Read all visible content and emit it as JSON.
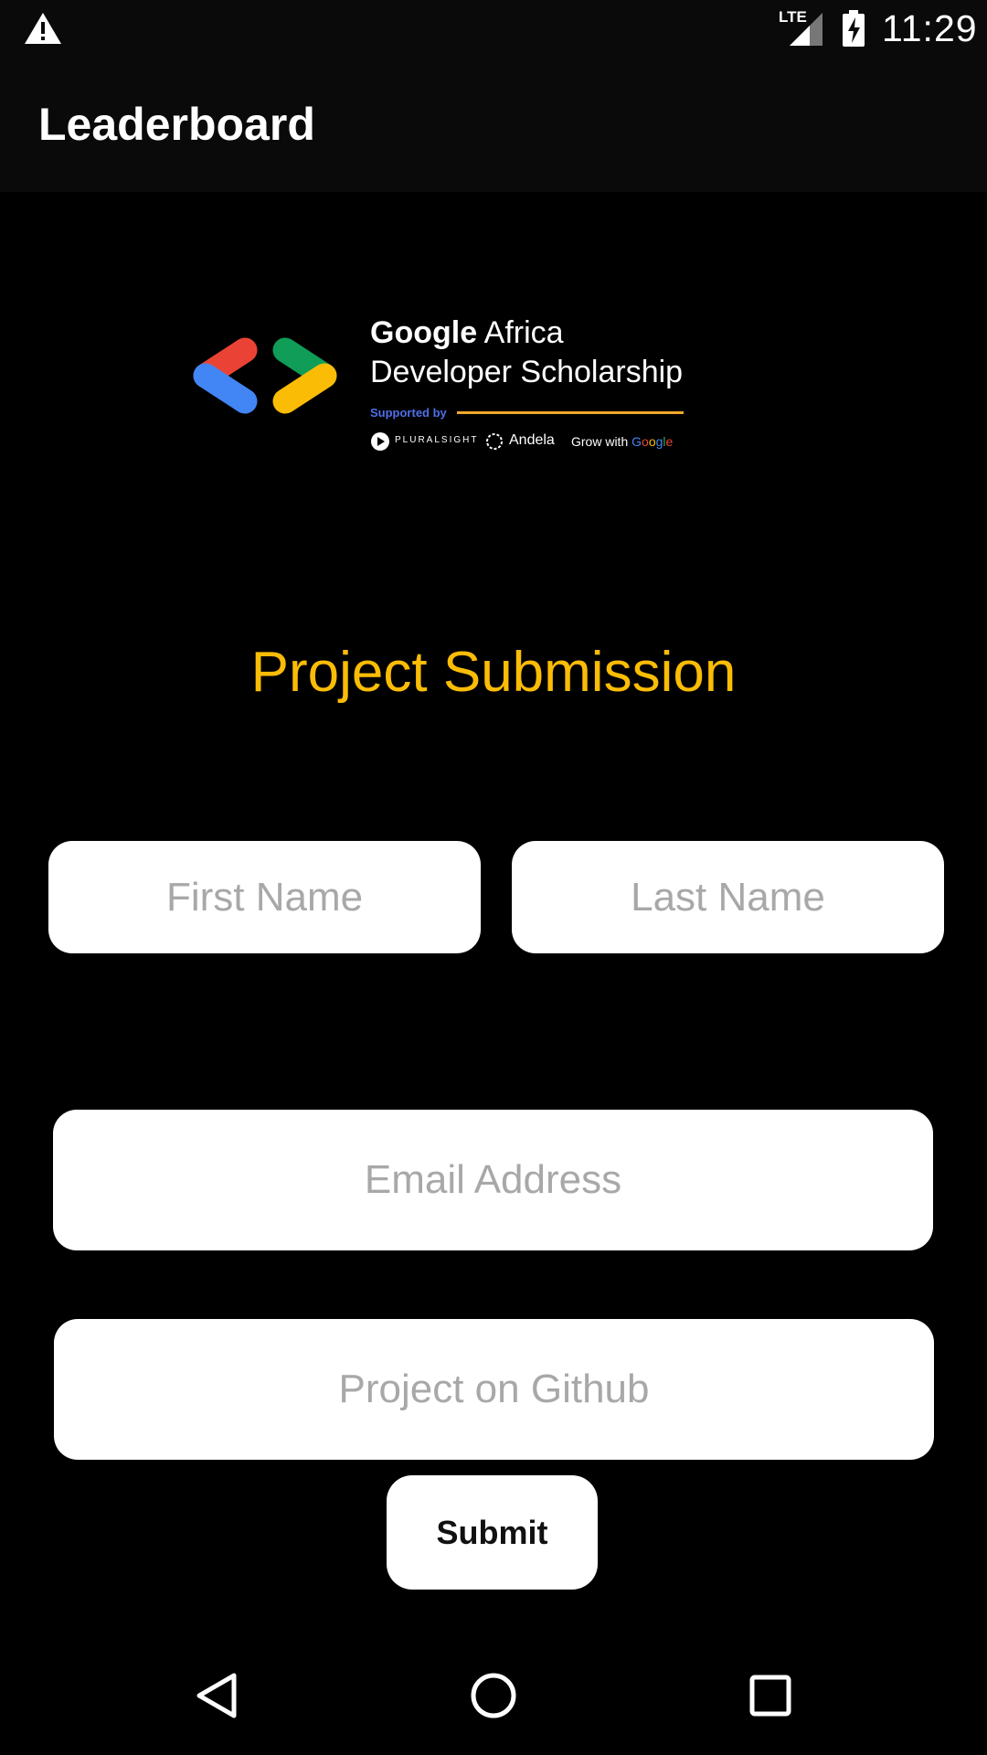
{
  "status_bar": {
    "time": "11:29",
    "network_label": "LTE",
    "icons": [
      "warning-icon",
      "signal-icon",
      "battery-charging-icon"
    ]
  },
  "app_bar": {
    "title": "Leaderboard"
  },
  "logo": {
    "line1_bold": "Google",
    "line1_rest": " Africa",
    "line2": "Developer Scholarship",
    "supported_by": "Supported by",
    "partners": {
      "pluralsight": "PLURALSIGHT",
      "andela": "Andela",
      "grow_prefix": "Grow with ",
      "google_letters": [
        "G",
        "o",
        "o",
        "g",
        "l",
        "e"
      ]
    },
    "colors": {
      "red": "#ea4335",
      "blue": "#4285f4",
      "green": "#0f9d58",
      "yellow": "#fbbc05"
    }
  },
  "form": {
    "heading": "Project Submission",
    "heading_color": "#fbbc05",
    "first_name_placeholder": "First Name",
    "last_name_placeholder": "Last Name",
    "email_placeholder": "Email Address",
    "github_placeholder": "Project on Github",
    "submit_label": "Submit"
  },
  "nav_bar": {
    "buttons": [
      "back-icon",
      "home-icon",
      "recent-apps-icon"
    ]
  }
}
